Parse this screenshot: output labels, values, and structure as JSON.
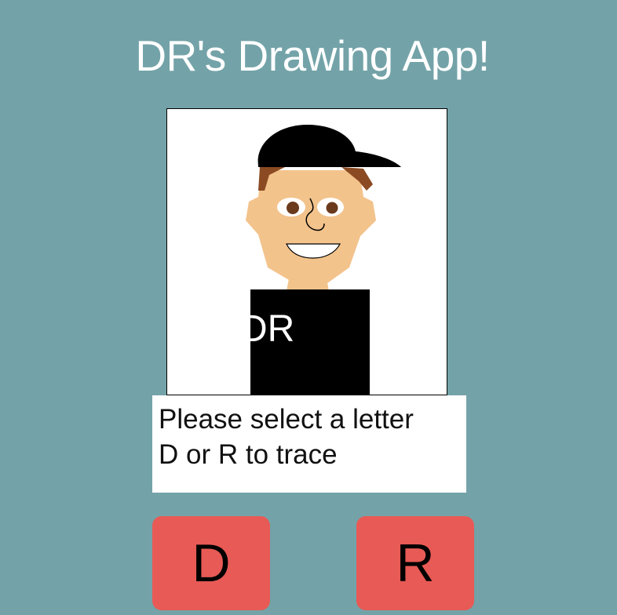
{
  "app": {
    "title": "DR's Drawing App!"
  },
  "canvas": {
    "shirt_text": "DR",
    "colors": {
      "skin": "#f3c38c",
      "hair": "#8b4a22",
      "cap": "#000000",
      "shirt": "#000000",
      "eye_white": "#ffffff",
      "pupil": "#6b3a1d"
    }
  },
  "instructions": {
    "line1": "Please select a letter",
    "line2": "D or R to trace"
  },
  "buttons": {
    "d_label": "D",
    "r_label": "R",
    "color": "#e85a55"
  },
  "theme": {
    "background": "#73a3a8"
  }
}
